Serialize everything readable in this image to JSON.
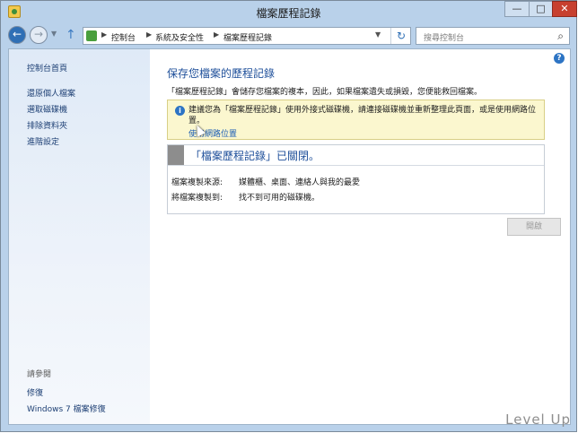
{
  "window": {
    "title": "檔案歷程記錄",
    "controls": {
      "minimize": "—",
      "maximize": "□",
      "close": "✕"
    }
  },
  "navigation": {
    "back_icon": "arrow-left-icon",
    "forward_icon": "arrow-right-icon",
    "breadcrumbs": [
      "控制台",
      "系統及安全性",
      "檔案歷程記錄"
    ],
    "search_placeholder": "搜尋控制台"
  },
  "sidebar": {
    "home": "控制台首頁",
    "items": [
      "還原個人檔案",
      "選取磁碟機",
      "排除資料夾",
      "進階設定"
    ],
    "see_also_label": "請參閱",
    "see_also_items": [
      "修復",
      "Windows 7 檔案修復"
    ]
  },
  "main": {
    "heading": "保存您檔案的歷程記錄",
    "description": "「檔案歷程記錄」會儲存您檔案的複本，因此，如果檔案遺失或損毀，您便能救回檔案。",
    "notice": {
      "text": "建議您為「檔案歷程記錄」使用外接式磁碟機，請連接磁碟機並重新整理此頁面，或是使用網路位置。",
      "link": "使用網路位置"
    },
    "status": "「檔案歷程記錄」已關閉。",
    "details": [
      {
        "label": "檔案複製來源:",
        "value": "媒體櫃、桌面、連絡人與我的最愛"
      },
      {
        "label": "將檔案複製到:",
        "value": "找不到可用的磁碟機。"
      }
    ],
    "enable_button": "開啟"
  },
  "watermark": "Level Up"
}
